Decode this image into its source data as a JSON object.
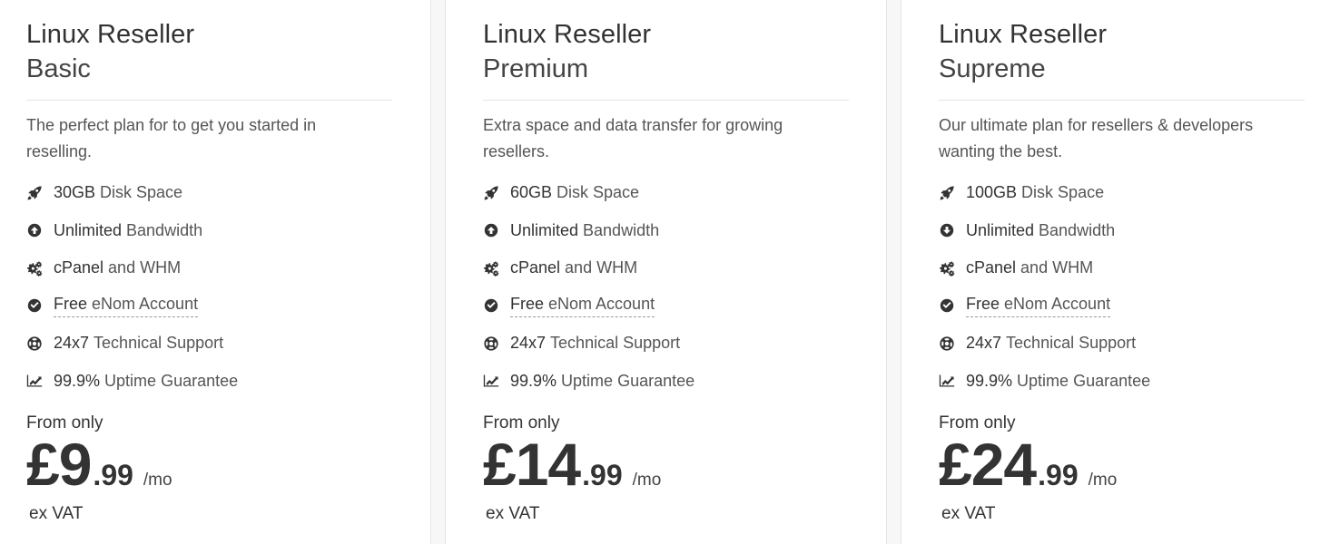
{
  "plans": [
    {
      "title": "Linux Reseller",
      "subtitle": "Basic",
      "description": "The perfect plan for to get you started in reselling.",
      "features": [
        {
          "icon": "rocket-icon",
          "strong": "30GB",
          "text": "Disk Space"
        },
        {
          "icon": "arrow-up-circle-icon",
          "strong": "Unlimited",
          "text": "Bandwidth"
        },
        {
          "icon": "cogs-icon",
          "strong": "cPanel",
          "text": "and WHM"
        },
        {
          "icon": "check-circle-icon",
          "strong": "Free",
          "text": "eNom Account"
        },
        {
          "icon": "life-ring-icon",
          "strong": "24x7",
          "text": "Technical Support"
        },
        {
          "icon": "line-chart-icon",
          "strong": "99.9%",
          "text": "Uptime Guarantee"
        }
      ],
      "from_label": "From only",
      "price_main": "£9",
      "price_cents": ".99",
      "price_period": "/mo",
      "vat_label": "ex VAT"
    },
    {
      "title": "Linux Reseller",
      "subtitle": "Premium",
      "description": "Extra space and data transfer for growing resellers.",
      "features": [
        {
          "icon": "rocket-icon",
          "strong": "60GB",
          "text": "Disk Space"
        },
        {
          "icon": "arrow-up-circle-icon",
          "strong": "Unlimited",
          "text": "Bandwidth"
        },
        {
          "icon": "cogs-icon",
          "strong": "cPanel",
          "text": "and WHM"
        },
        {
          "icon": "check-circle-icon",
          "strong": "Free",
          "text": "eNom Account"
        },
        {
          "icon": "life-ring-icon",
          "strong": "24x7",
          "text": "Technical Support"
        },
        {
          "icon": "line-chart-icon",
          "strong": "99.9%",
          "text": "Uptime Guarantee"
        }
      ],
      "from_label": "From only",
      "price_main": "£14",
      "price_cents": ".99",
      "price_period": "/mo",
      "vat_label": "ex VAT"
    },
    {
      "title": "Linux Reseller",
      "subtitle": "Supreme",
      "description": "Our ultimate plan for resellers & developers wanting the best.",
      "features": [
        {
          "icon": "rocket-icon",
          "strong": "100GB",
          "text": "Disk Space"
        },
        {
          "icon": "arrow-down-circle-icon",
          "strong": "Unlimited",
          "text": "Bandwidth"
        },
        {
          "icon": "cogs-icon",
          "strong": "cPanel",
          "text": "and WHM"
        },
        {
          "icon": "check-circle-icon",
          "strong": "Free",
          "text": "eNom Account"
        },
        {
          "icon": "life-ring-icon",
          "strong": "24x7",
          "text": "Technical Support"
        },
        {
          "icon": "line-chart-icon",
          "strong": "99.9%",
          "text": "Uptime Guarantee"
        }
      ],
      "from_label": "From only",
      "price_main": "£24",
      "price_cents": ".99",
      "price_period": "/mo",
      "vat_label": "ex VAT"
    }
  ]
}
